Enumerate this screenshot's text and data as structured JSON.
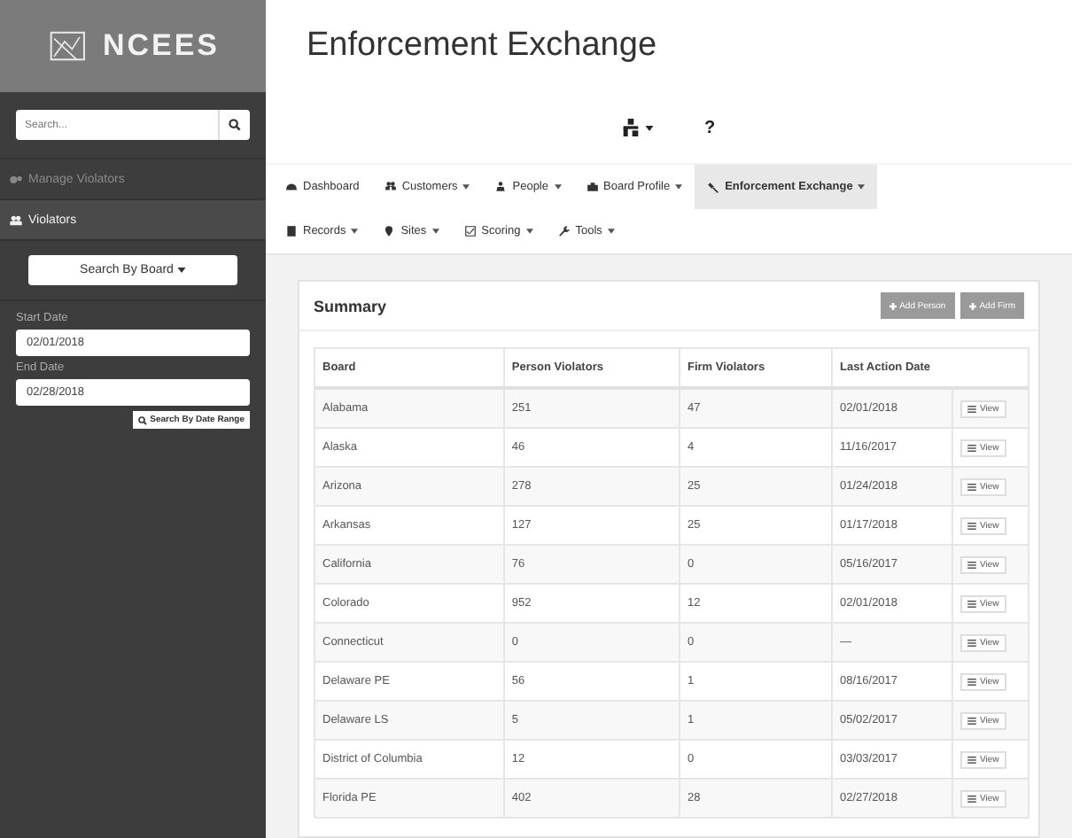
{
  "sidebar": {
    "logo": "NCEES",
    "search": {
      "placeholder": "Search..."
    },
    "items": [
      {
        "label": "Manage Violators",
        "kind": "section",
        "selected": false
      },
      {
        "label": "Violators",
        "kind": "group",
        "selected": true
      }
    ],
    "board_dropdown": "Search By Board",
    "start_date": {
      "label": "Start Date",
      "value": "02/01/2018"
    },
    "end_date": {
      "label": "End Date",
      "value": "02/28/2018"
    },
    "date_search_button": "Search By Date Range"
  },
  "page_title": "Enforcement Exchange",
  "top_bar": {
    "help": "?"
  },
  "nav": [
    [
      {
        "label": "Dashboard",
        "dropdown": false,
        "selected": false
      },
      {
        "label": "Customers",
        "dropdown": true,
        "selected": false
      },
      {
        "label": "People",
        "dropdown": true,
        "selected": false
      },
      {
        "label": "Board Profile",
        "dropdown": true,
        "selected": false
      },
      {
        "label": "Enforcement Exchange",
        "dropdown": true,
        "selected": true
      }
    ],
    [
      {
        "label": "Records",
        "dropdown": true,
        "selected": false
      },
      {
        "label": "Sites",
        "dropdown": true,
        "selected": false
      },
      {
        "label": "Scoring",
        "dropdown": true,
        "selected": false
      },
      {
        "label": "Tools",
        "dropdown": true,
        "selected": false
      }
    ]
  ],
  "summary": {
    "title": "Summary",
    "buttons": [
      "Add Person",
      "Add Firm"
    ],
    "columns": [
      "Board",
      "Person Violators",
      "Firm Violators",
      "Last Action Date"
    ],
    "rows": [
      {
        "cells": [
          "Alabama",
          "251",
          "47",
          "02/01/2018"
        ],
        "action": "View"
      },
      {
        "cells": [
          "Alaska",
          "46",
          "4",
          "11/16/2017"
        ],
        "action": "View"
      },
      {
        "cells": [
          "Arizona",
          "278",
          "25",
          "01/24/2018"
        ],
        "action": "View"
      },
      {
        "cells": [
          "Arkansas",
          "127",
          "25",
          "01/17/2018"
        ],
        "action": "View"
      },
      {
        "cells": [
          "California",
          "76",
          "0",
          "05/16/2017"
        ],
        "action": "View"
      },
      {
        "cells": [
          "Colorado",
          "952",
          "12",
          "02/01/2018"
        ],
        "action": "View"
      },
      {
        "cells": [
          "Connecticut",
          "0",
          "0",
          "—"
        ],
        "action": "View"
      },
      {
        "cells": [
          "Delaware PE",
          "56",
          "1",
          "08/16/2017"
        ],
        "action": "View"
      },
      {
        "cells": [
          "Delaware LS",
          "5",
          "1",
          "05/02/2017"
        ],
        "action": "View"
      },
      {
        "cells": [
          "District of Columbia",
          "12",
          "0",
          "03/03/2017"
        ],
        "action": "View"
      },
      {
        "cells": [
          "Florida PE",
          "402",
          "28",
          "02/27/2018"
        ],
        "action": "View"
      }
    ]
  }
}
